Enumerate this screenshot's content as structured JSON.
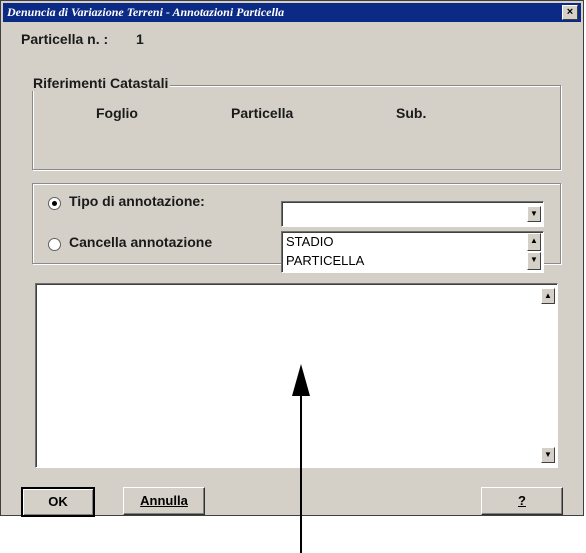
{
  "window": {
    "title": "Denuncia di Variazione Terreni - Annotazioni Particella",
    "close_glyph": "×"
  },
  "particella": {
    "label": "Particella n. :",
    "value": "1"
  },
  "riferimenti": {
    "group_title": "Riferimenti Catastali",
    "columns": [
      "Foglio",
      "Particella",
      "Sub."
    ]
  },
  "annotazione": {
    "option_tipo": "Tipo di annotazione:",
    "option_cancella": "Cancella annotazione",
    "selected_option": "Tipo di annotazione:",
    "combo_value": "",
    "list_items": [
      "STADIO",
      "PARTICELLA"
    ]
  },
  "buttons": {
    "ok": "OK",
    "annulla": "Annulla",
    "help": "?"
  },
  "colors": {
    "title_bar": "#0a2a86",
    "window_face": "#d4d0c8"
  }
}
